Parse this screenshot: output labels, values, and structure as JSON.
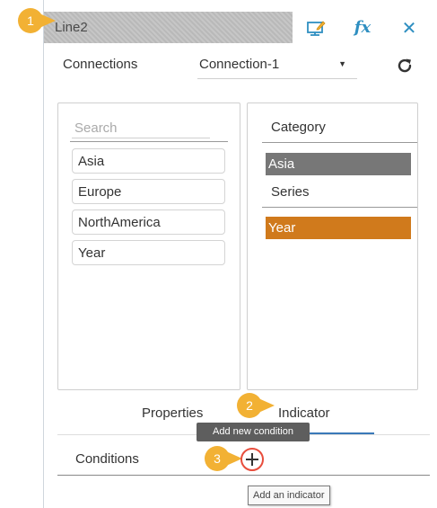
{
  "window": {
    "title": "Line2"
  },
  "toolbar": {
    "icons": [
      "edit-chart-icon",
      "fx-icon",
      "close-icon"
    ],
    "fx_label": "fx",
    "close_glyph": "✕"
  },
  "badges": {
    "step1": "1",
    "step2": "2",
    "step3": "3"
  },
  "connections": {
    "label": "Connections",
    "selected": "Connection-1",
    "caret": "▼"
  },
  "fields": {
    "search_placeholder": "Search",
    "items": [
      {
        "label": "Asia"
      },
      {
        "label": "Europe"
      },
      {
        "label": "NorthAmerica"
      },
      {
        "label": "Year"
      }
    ]
  },
  "category": {
    "label": "Category",
    "category_item": "Asia",
    "series_label": "Series",
    "series_item": "Year"
  },
  "tabs": {
    "properties": "Properties",
    "indicator": "Indicator"
  },
  "tooltips": {
    "add_condition": "Add new condition",
    "add_indicator": "Add an indicator"
  },
  "conditions": {
    "label": "Conditions"
  },
  "colors": {
    "title_bar": "#bdbdbd",
    "badge": "#f2b134",
    "accent_blue": "#3a79b8",
    "category_chip": "#777777",
    "series_chip": "#d07a1c",
    "add_button_ring": "#e84d3c"
  }
}
